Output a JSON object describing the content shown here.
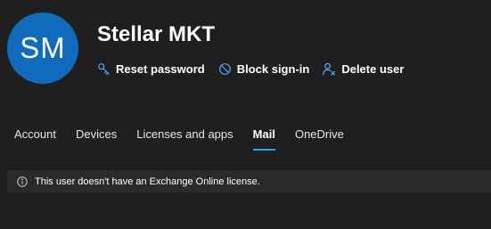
{
  "user": {
    "initials": "SM",
    "name": "Stellar MKT",
    "avatar_color": "#0f6cbd"
  },
  "actions": [
    {
      "label": "Reset password",
      "icon": "key-icon"
    },
    {
      "label": "Block sign-in",
      "icon": "block-icon"
    },
    {
      "label": "Delete user",
      "icon": "delete-user-icon"
    }
  ],
  "tabs": [
    {
      "label": "Account",
      "active": false
    },
    {
      "label": "Devices",
      "active": false
    },
    {
      "label": "Licenses and apps",
      "active": false
    },
    {
      "label": "Mail",
      "active": true
    },
    {
      "label": "OneDrive",
      "active": false
    }
  ],
  "notice": {
    "icon": "info-icon",
    "text": "This user doesn't have an Exchange Online license."
  },
  "colors": {
    "background": "#1f1f1f",
    "accent": "#2f9bff",
    "notice_background": "#2a2a2a"
  }
}
